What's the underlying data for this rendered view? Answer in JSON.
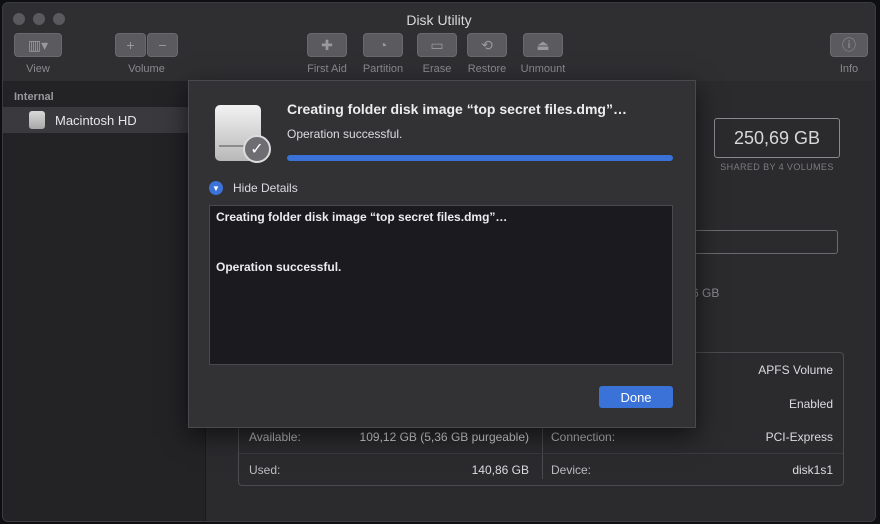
{
  "window": {
    "title": "Disk Utility"
  },
  "toolbar": {
    "view_label": "View",
    "volume_label": "Volume",
    "first_aid_label": "First Aid",
    "partition_label": "Partition",
    "erase_label": "Erase",
    "restore_label": "Restore",
    "unmount_label": "Unmount",
    "info_label": "Info",
    "volume_add": "+",
    "volume_remove": "−"
  },
  "sidebar": {
    "section": "Internal",
    "items": [
      {
        "label": "Macintosh HD"
      }
    ]
  },
  "main": {
    "capacity": "250,69 GB",
    "capacity_caption": "SHARED BY 4 VOLUMES",
    "partial_value": "6 GB",
    "info": {
      "rows": [
        {
          "label": "",
          "value": "APFS Volume"
        },
        {
          "label": "",
          "value": "Enabled"
        }
      ],
      "available_label": "Available:",
      "available_value": "109,12 GB (5,36 GB purgeable)",
      "used_label": "Used:",
      "used_value": "140,86 GB",
      "connection_label": "Connection:",
      "connection_value": "PCI-Express",
      "device_label": "Device:",
      "device_value": "disk1s1"
    }
  },
  "sheet": {
    "title": "Creating folder disk image “top secret files.dmg”…",
    "status": "Operation successful.",
    "progress": 1.0,
    "details_toggle": "Hide Details",
    "log": [
      "Creating folder disk image “top secret files.dmg”…",
      "Operation successful."
    ],
    "done_label": "Done"
  },
  "colors": {
    "accent": "#3a72d8",
    "window_bg": "#2a2a2d"
  }
}
